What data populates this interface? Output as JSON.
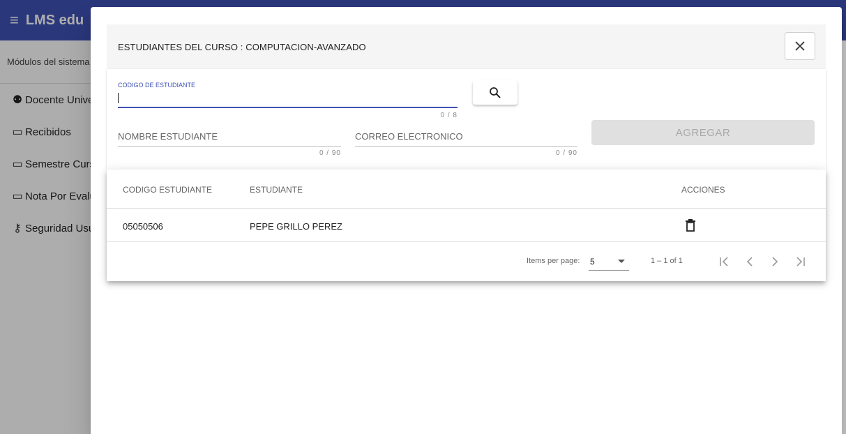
{
  "app": {
    "title": "LMS edu",
    "sidenav_header": "Módulos del sistema",
    "nav_items": [
      {
        "icon": "group-icon",
        "label": "Docente Universitario"
      },
      {
        "icon": "laptop-icon",
        "label": "Recibidos"
      },
      {
        "icon": "laptop-icon",
        "label": "Semestre Curso"
      },
      {
        "icon": "laptop-icon",
        "label": "Nota Por Evaluación"
      },
      {
        "icon": "key-icon",
        "label": "Seguridad Usuarios"
      }
    ]
  },
  "dialog": {
    "title": "ESTUDIANTES DEL CURSO : COMPUTACION-AVANZADO",
    "form": {
      "code_label": "CODIGO DE ESTUDIANTE",
      "code_value": "",
      "code_hint": "0 / 8",
      "name_label": "NOMBRE ESTUDIANTE",
      "name_hint": "0 / 90",
      "email_label": "CORREO ELECTRONICO",
      "email_hint": "0 / 90",
      "add_button": "AGREGAR"
    },
    "table": {
      "columns": [
        "CODIGO ESTUDIANTE",
        "ESTUDIANTE",
        "ACCIONES"
      ],
      "rows": [
        {
          "code": "05050506",
          "name": "PEPE GRILLO PEREZ"
        }
      ]
    },
    "paginator": {
      "items_per_page_label": "Items per page:",
      "page_size": "5",
      "range": "1 – 1 of 1"
    }
  },
  "colors": {
    "primary": "#3f51b5",
    "disabled_button": "#e0e0e0"
  }
}
